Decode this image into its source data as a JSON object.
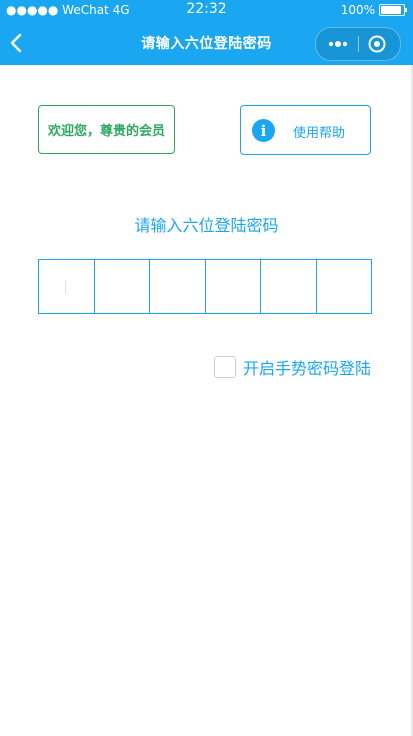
{
  "status_bar": {
    "carrier": "●●●●● WeChat 4G",
    "time": "22:32",
    "battery": "100%"
  },
  "nav": {
    "title": "请输入六位登陆密码"
  },
  "welcome": {
    "label": "欢迎您，尊贵的会员"
  },
  "help": {
    "icon": "i",
    "label": "使用帮助"
  },
  "pin": {
    "prompt": "请输入六位登陆密码",
    "length": 6
  },
  "gesture": {
    "label": "开启手势密码登陆"
  },
  "colors": {
    "primary": "#1aa6f0",
    "welcome_green": "#2fa85f"
  }
}
